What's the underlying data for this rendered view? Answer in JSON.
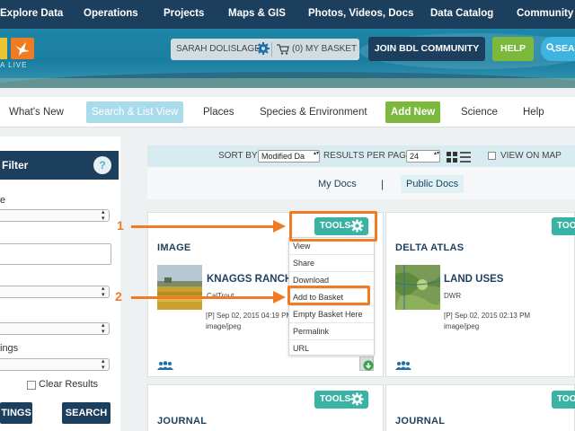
{
  "topnav": [
    "Explore Data",
    "Operations",
    "Projects",
    "Maps & GIS",
    "Photos, Videos, Docs",
    "Data Catalog",
    "Community"
  ],
  "header": {
    "logo_tagline": "A LIVE",
    "user_name": "SARAH DOLISLAGER",
    "basket_label": "(0) MY BASKET",
    "join_label": "JOIN BDL COMMUNITY",
    "help_label": "HELP",
    "search_label": "SEAR"
  },
  "tabs": [
    "What's New",
    "Search & List View",
    "Places",
    "Species & Environment",
    "Add New",
    "Science",
    "Help"
  ],
  "active_tab": "Search & List View",
  "filter": {
    "title": "Filter",
    "help_glyph": "?",
    "label_1": "e",
    "label_2": "ings",
    "clear_results": "Clear Results",
    "settings_btn": "TINGS",
    "search_btn": "SEARCH"
  },
  "sortbar": {
    "sort_by": "SORT BY",
    "sort_value": "Modified Da",
    "results_per_page": "RESULTS PER PAGE",
    "per_page_value": "24",
    "view_on_map": "VIEW ON MAP"
  },
  "docs": {
    "my_docs": "My Docs",
    "separator": "|",
    "public_docs": "Public Docs"
  },
  "cards": [
    {
      "tools_label": "TOOLS",
      "type": "IMAGE",
      "title": "KNAGGS RANCH",
      "owner": "CalTrout",
      "meta": "[P] Sep 02, 2015 04:19 PM",
      "mime": "image/jpeg"
    },
    {
      "tools_label": "TOOLS",
      "type": "DELTA ATLAS",
      "title": "LAND USES",
      "owner": "DWR",
      "meta": "[P] Sep 02, 2015 02:13 PM",
      "mime": "image/jpeg"
    },
    {
      "tools_label": "TOOLS",
      "type": "JOURNAL"
    },
    {
      "tools_label": "TOOLS",
      "type": "JOURNAL"
    }
  ],
  "tools_menu": [
    "View",
    "Share",
    "Download",
    "Add to Basket",
    "Empty Basket Here",
    "Permalink",
    "URL"
  ],
  "annotations": {
    "step1": "1",
    "step2": "2"
  },
  "colors": {
    "navy": "#1d3f5e",
    "green": "#7cb83b",
    "teal": "#3bb3a4",
    "orange": "#f07b22",
    "light_blue": "#a9dcea"
  }
}
